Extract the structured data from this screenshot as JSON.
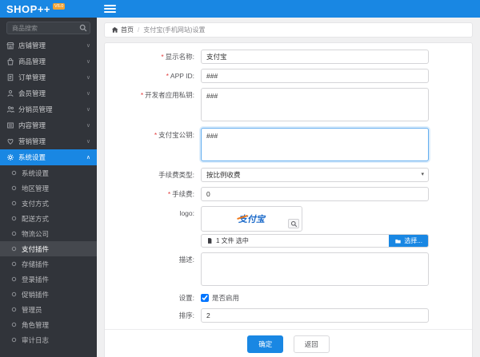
{
  "colors": {
    "accent": "#1987e3",
    "sidebar_bg": "#31343a",
    "badge": "#f0a233",
    "required": "#e23c3c",
    "alipay_blue": "#1767c8",
    "alipay_orange": "#f07818"
  },
  "app": {
    "logo": "SHOP++",
    "badge": "V6.0"
  },
  "sidebar": {
    "search_placeholder": "商品搜索",
    "menu": [
      {
        "label": "店铺管理",
        "icon": "store-icon"
      },
      {
        "label": "商品管理",
        "icon": "goods-icon"
      },
      {
        "label": "订单管理",
        "icon": "order-icon"
      },
      {
        "label": "会员管理",
        "icon": "member-icon"
      },
      {
        "label": "分销员管理",
        "icon": "distributor-icon"
      },
      {
        "label": "内容管理",
        "icon": "content-icon"
      },
      {
        "label": "营销管理",
        "icon": "heart-icon"
      },
      {
        "label": "系统设置",
        "icon": "gear-icon",
        "active": true,
        "expanded": true
      }
    ],
    "submenu": [
      {
        "label": "系统设置"
      },
      {
        "label": "地区管理"
      },
      {
        "label": "支付方式"
      },
      {
        "label": "配送方式"
      },
      {
        "label": "物流公司"
      },
      {
        "label": "支付插件",
        "active": true
      },
      {
        "label": "存储插件"
      },
      {
        "label": "登录插件"
      },
      {
        "label": "促销插件"
      },
      {
        "label": "管理员"
      },
      {
        "label": "角色管理"
      },
      {
        "label": "审计日志"
      }
    ]
  },
  "breadcrumb": {
    "home_label": "首页",
    "separator": "/",
    "current": "支付宝(手机网站)设置"
  },
  "form": {
    "display_name": {
      "label": "显示名称:",
      "value": "支付宝",
      "required": true
    },
    "app_id": {
      "label": "APP ID:",
      "value": "###",
      "required": true
    },
    "private_key": {
      "label": "开发者应用私钥:",
      "value": "###",
      "required": true
    },
    "public_key": {
      "label": "支付宝公钥:",
      "value": "###",
      "required": true,
      "focused": true
    },
    "fee_type": {
      "label": "手续费类型:",
      "value": "按比例收费"
    },
    "fee": {
      "label": "手续费:",
      "value": "0",
      "required": true
    },
    "logo": {
      "label": "logo:",
      "logo_text": "支付宝"
    },
    "file": {
      "text": "1 文件 选中",
      "button_label": "选择..."
    },
    "description": {
      "label": "描述:",
      "value": ""
    },
    "settings": {
      "label": "设置:",
      "checkbox_label": "是否启用",
      "checked": true
    },
    "sort": {
      "label": "排序:",
      "value": "2"
    }
  },
  "footer": {
    "ok_label": "确定",
    "back_label": "返回"
  }
}
